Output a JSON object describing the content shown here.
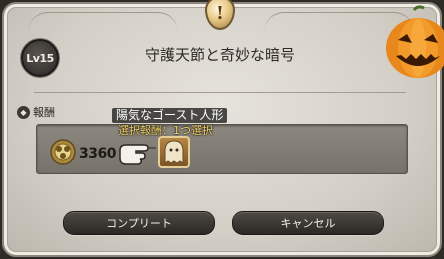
{
  "quest": {
    "level_badge": "Lv15",
    "title": "守護天節と奇妙な暗号",
    "icon_glyph": "!"
  },
  "rewards": {
    "section_label": "報酬",
    "gil_amount": "3360",
    "item_name": "陽気なゴースト人形",
    "selection_note": "選択報酬：1つ選択"
  },
  "buttons": {
    "complete_label": "コンプリート",
    "cancel_label": "キャンセル"
  },
  "colors": {
    "window_bg": "#d8d4cc",
    "button_bg": "#3a3631",
    "note_text": "#f4d36a",
    "pumpkin": "#e8871c"
  },
  "icons": [
    "quest-exclamation-icon",
    "pumpkin-icon",
    "reward-section-icon",
    "gil-icon",
    "pointer-hand-icon",
    "ghost-doll-icon"
  ]
}
